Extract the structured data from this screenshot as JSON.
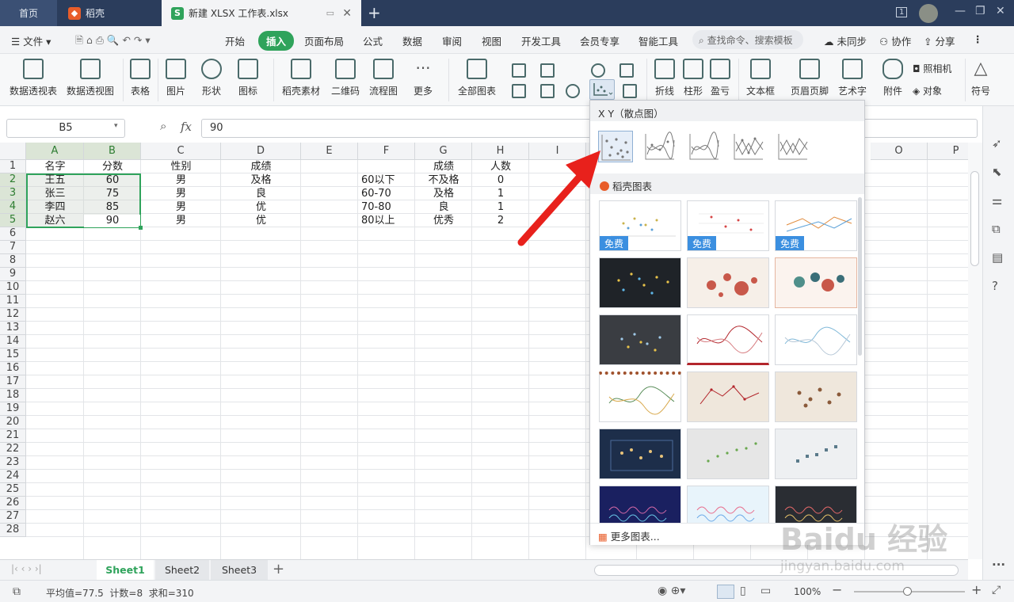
{
  "titlebar": {
    "tabs": [
      {
        "label": "首页"
      },
      {
        "label": "稻壳",
        "icon": "docer-flame-icon"
      },
      {
        "label": "新建 XLSX 工作表.xlsx",
        "icon": "spreadsheet-s-icon"
      }
    ],
    "window_badge": "1"
  },
  "menubar": {
    "file": "文件",
    "items": [
      "开始",
      "插入",
      "页面布局",
      "公式",
      "数据",
      "审阅",
      "视图",
      "开发工具",
      "会员专享",
      "智能工具"
    ],
    "active": "插入",
    "search_placeholder": "查找命令、搜索模板",
    "right": [
      "未同步",
      "协作",
      "分享"
    ]
  },
  "ribbon": {
    "buttons": [
      "数据透视表",
      "数据透视图",
      "表格",
      "图片",
      "形状",
      "图标",
      "稻壳素材",
      "二维码",
      "流程图",
      "更多",
      "全部图表",
      "折线",
      "柱形",
      "盈亏",
      "文本框",
      "页眉页脚",
      "艺术字",
      "附件",
      "照相机",
      "对象",
      "符号"
    ]
  },
  "formulabar": {
    "namebox": "B5",
    "fx": "fx",
    "value": "90"
  },
  "grid": {
    "columns": [
      "A",
      "B",
      "C",
      "D",
      "E",
      "F",
      "G",
      "H",
      "I",
      "O",
      "P"
    ],
    "rows": [
      "1",
      "2",
      "3",
      "4",
      "5",
      "6",
      "7",
      "8",
      "9",
      "10",
      "11",
      "12",
      "13",
      "14",
      "15",
      "16",
      "17",
      "18",
      "19",
      "20",
      "21",
      "22",
      "23",
      "24",
      "25",
      "26",
      "27",
      "28"
    ],
    "data": {
      "A1": "名字",
      "B1": "分数",
      "C1": "性别",
      "D1": "成绩",
      "G1": "成绩",
      "H1": "人数",
      "A2": "王五",
      "B2": "60",
      "C2": "男",
      "D2": "及格",
      "F2": "60以下",
      "G2": "不及格",
      "H2": "0",
      "A3": "张三",
      "B3": "75",
      "C3": "男",
      "D3": "良",
      "F3": "60-70",
      "G3": "及格",
      "H3": "1",
      "A4": "李四",
      "B4": "85",
      "C4": "男",
      "D4": "优",
      "F4": "70-80",
      "G4": "良",
      "H4": "1",
      "A5": "赵六",
      "B5": "90",
      "C5": "男",
      "D5": "优",
      "F5": "80以上",
      "G5": "优秀",
      "H5": "2"
    }
  },
  "sheets": [
    "Sheet1",
    "Sheet2",
    "Sheet3"
  ],
  "active_sheet": "Sheet1",
  "statusbar": {
    "stats": "平均值=77.5  计数=8  求和=310",
    "zoom": "100%"
  },
  "dropdown": {
    "title": "X Y（散点图）",
    "subtitle": "稻壳图表",
    "free_label": "免费",
    "more": "更多图表..."
  },
  "watermark": {
    "line1": "Baidu 经验",
    "line2": "jingyan.baidu.com"
  },
  "colors": {
    "accent": "#2fa35b",
    "titlebar": "#2b3d5c",
    "arrow": "#e8211c",
    "free_badge": "#3b8fe0"
  }
}
